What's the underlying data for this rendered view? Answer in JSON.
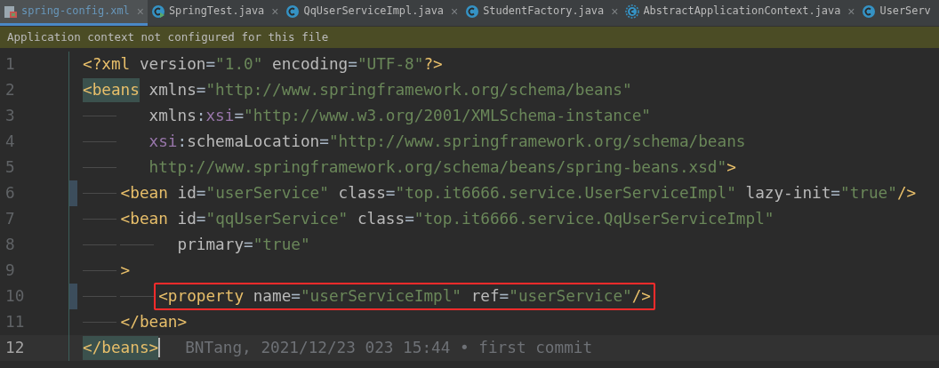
{
  "tabs": [
    {
      "label": "spring-config.xml",
      "kind": "xml",
      "selected": true,
      "close": "×"
    },
    {
      "label": "SpringTest.java",
      "kind": "test",
      "selected": false,
      "close": "×"
    },
    {
      "label": "QqUserServiceImpl.java",
      "kind": "class",
      "selected": false,
      "close": "×"
    },
    {
      "label": "StudentFactory.java",
      "kind": "class",
      "selected": false,
      "close": "×"
    },
    {
      "label": "AbstractApplicationContext.java",
      "kind": "abstract",
      "selected": false,
      "close": "×"
    },
    {
      "label": "UserServ",
      "kind": "class",
      "selected": false
    }
  ],
  "banner": "Application context not configured for this file",
  "lines": [
    {
      "number": "1",
      "current": false,
      "marker": false,
      "boxed": false,
      "tokens": [
        {
          "kind": "tag",
          "text": "<?xml"
        },
        {
          "kind": "attr",
          "text": " version"
        },
        {
          "kind": "punct",
          "text": "="
        },
        {
          "kind": "value",
          "text": "\"1.0\""
        },
        {
          "kind": "attr",
          "text": " encoding"
        },
        {
          "kind": "punct",
          "text": "="
        },
        {
          "kind": "value",
          "text": "\"UTF-8\""
        },
        {
          "kind": "tag",
          "text": "?>"
        }
      ]
    },
    {
      "number": "2",
      "current": false,
      "marker": false,
      "boxed": false,
      "tokens": [
        {
          "kind": "tag",
          "text": "<beans",
          "match": true
        },
        {
          "kind": "attr",
          "text": " xmlns"
        },
        {
          "kind": "punct",
          "text": "="
        },
        {
          "kind": "value",
          "text": "\"http://www.springframework.org/schema/beans\""
        }
      ]
    },
    {
      "number": "3",
      "current": false,
      "marker": false,
      "boxed": false,
      "tokens": [
        {
          "kind": "attr",
          "text": "       xmlns"
        },
        {
          "kind": "punct",
          "text": ":"
        },
        {
          "kind": "ns",
          "text": "xsi"
        },
        {
          "kind": "punct",
          "text": "="
        },
        {
          "kind": "value",
          "text": "\"http://www.w3.org/2001/XMLSchema-instance\""
        }
      ]
    },
    {
      "number": "4",
      "current": false,
      "marker": false,
      "boxed": false,
      "tokens": [
        {
          "kind": "ns",
          "text": "       xsi"
        },
        {
          "kind": "punct",
          "text": ":"
        },
        {
          "kind": "attr",
          "text": "schemaLocation"
        },
        {
          "kind": "punct",
          "text": "="
        },
        {
          "kind": "value",
          "text": "\"http://www.springframework.org/schema/beans"
        }
      ]
    },
    {
      "number": "5",
      "current": false,
      "marker": false,
      "boxed": false,
      "tokens": [
        {
          "kind": "value",
          "text": "       http://www.springframework.org/schema/beans/spring-beans.xsd\""
        },
        {
          "kind": "tag",
          "text": ">"
        }
      ]
    },
    {
      "number": "6",
      "current": false,
      "marker": true,
      "boxed": false,
      "tokens": [
        {
          "kind": "tag",
          "text": "    <bean"
        },
        {
          "kind": "attr",
          "text": " id"
        },
        {
          "kind": "punct",
          "text": "="
        },
        {
          "kind": "value",
          "text": "\"userService\""
        },
        {
          "kind": "attr",
          "text": " class"
        },
        {
          "kind": "punct",
          "text": "="
        },
        {
          "kind": "value",
          "text": "\"top.it6666.service.UserServiceImpl\""
        },
        {
          "kind": "attr",
          "text": " lazy-init"
        },
        {
          "kind": "punct",
          "text": "="
        },
        {
          "kind": "value",
          "text": "\"true\""
        },
        {
          "kind": "tag",
          "text": "/>"
        }
      ]
    },
    {
      "number": "7",
      "current": false,
      "marker": false,
      "boxed": false,
      "tokens": [
        {
          "kind": "tag",
          "text": "    <bean"
        },
        {
          "kind": "attr",
          "text": " id"
        },
        {
          "kind": "punct",
          "text": "="
        },
        {
          "kind": "value",
          "text": "\"qqUserService\""
        },
        {
          "kind": "attr",
          "text": " class"
        },
        {
          "kind": "punct",
          "text": "="
        },
        {
          "kind": "value",
          "text": "\"top.it6666.service.QqUserServiceImpl\""
        }
      ]
    },
    {
      "number": "8",
      "current": false,
      "marker": false,
      "boxed": false,
      "tokens": [
        {
          "kind": "attr",
          "text": "          primary"
        },
        {
          "kind": "punct",
          "text": "="
        },
        {
          "kind": "value",
          "text": "\"true\""
        }
      ]
    },
    {
      "number": "9",
      "current": false,
      "marker": false,
      "boxed": false,
      "tokens": [
        {
          "kind": "tag",
          "text": "    >"
        }
      ]
    },
    {
      "number": "10",
      "current": false,
      "marker": true,
      "boxed": true,
      "tokens": [
        {
          "kind": "tag",
          "text": "        <property"
        },
        {
          "kind": "attr",
          "text": " name"
        },
        {
          "kind": "punct",
          "text": "="
        },
        {
          "kind": "value",
          "text": "\"userServiceImpl\""
        },
        {
          "kind": "attr",
          "text": " ref"
        },
        {
          "kind": "punct",
          "text": "="
        },
        {
          "kind": "value",
          "text": "\"userService\""
        },
        {
          "kind": "tag",
          "text": "/>"
        }
      ]
    },
    {
      "number": "11",
      "current": false,
      "marker": false,
      "boxed": false,
      "tokens": [
        {
          "kind": "tag",
          "text": "    </bean>"
        }
      ]
    },
    {
      "number": "12",
      "current": true,
      "marker": false,
      "boxed": false,
      "blame": "BNTang, 2021/12/23 023 15:44 • first commit",
      "tokens": [
        {
          "kind": "tag",
          "text": "</beans>",
          "match": true
        }
      ]
    }
  ]
}
